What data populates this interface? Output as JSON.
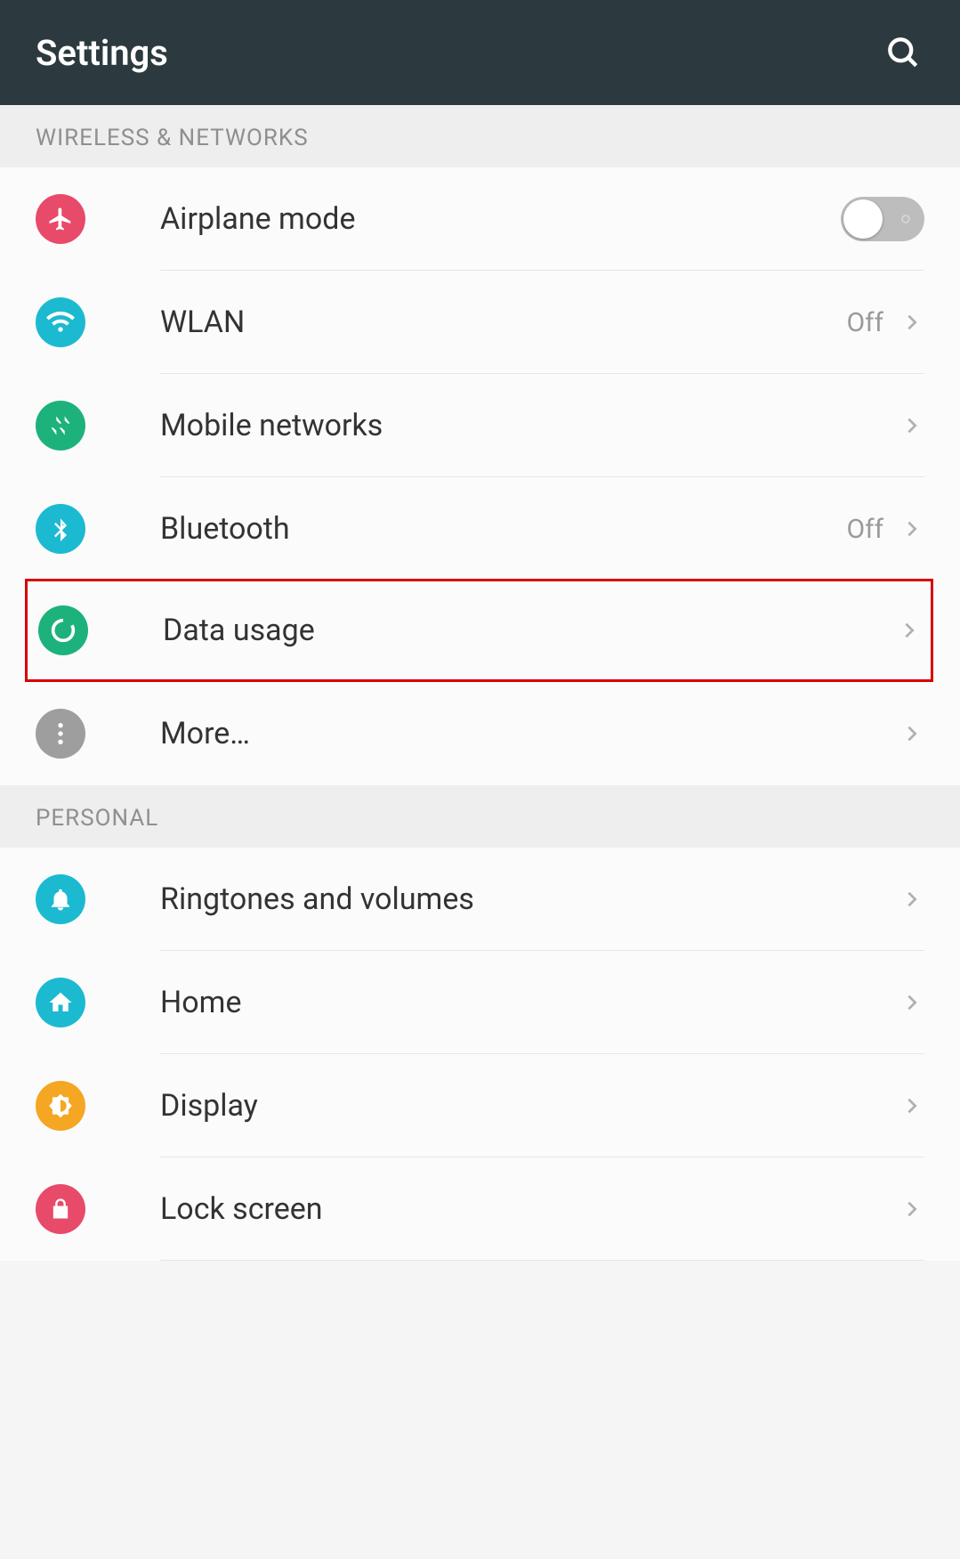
{
  "header": {
    "title": "Settings"
  },
  "sections": {
    "wireless": {
      "title": "WIRELESS & NETWORKS",
      "items": {
        "airplane": {
          "label": "Airplane mode",
          "toggle": false
        },
        "wlan": {
          "label": "WLAN",
          "value": "Off"
        },
        "mobile": {
          "label": "Mobile networks"
        },
        "bluetooth": {
          "label": "Bluetooth",
          "value": "Off"
        },
        "data": {
          "label": "Data usage"
        },
        "more": {
          "label": "More…"
        }
      }
    },
    "personal": {
      "title": "PERSONAL",
      "items": {
        "ringtones": {
          "label": "Ringtones and volumes"
        },
        "home": {
          "label": "Home"
        },
        "display": {
          "label": "Display"
        },
        "lock": {
          "label": "Lock screen"
        }
      }
    }
  },
  "highlighted_item": "data-usage"
}
